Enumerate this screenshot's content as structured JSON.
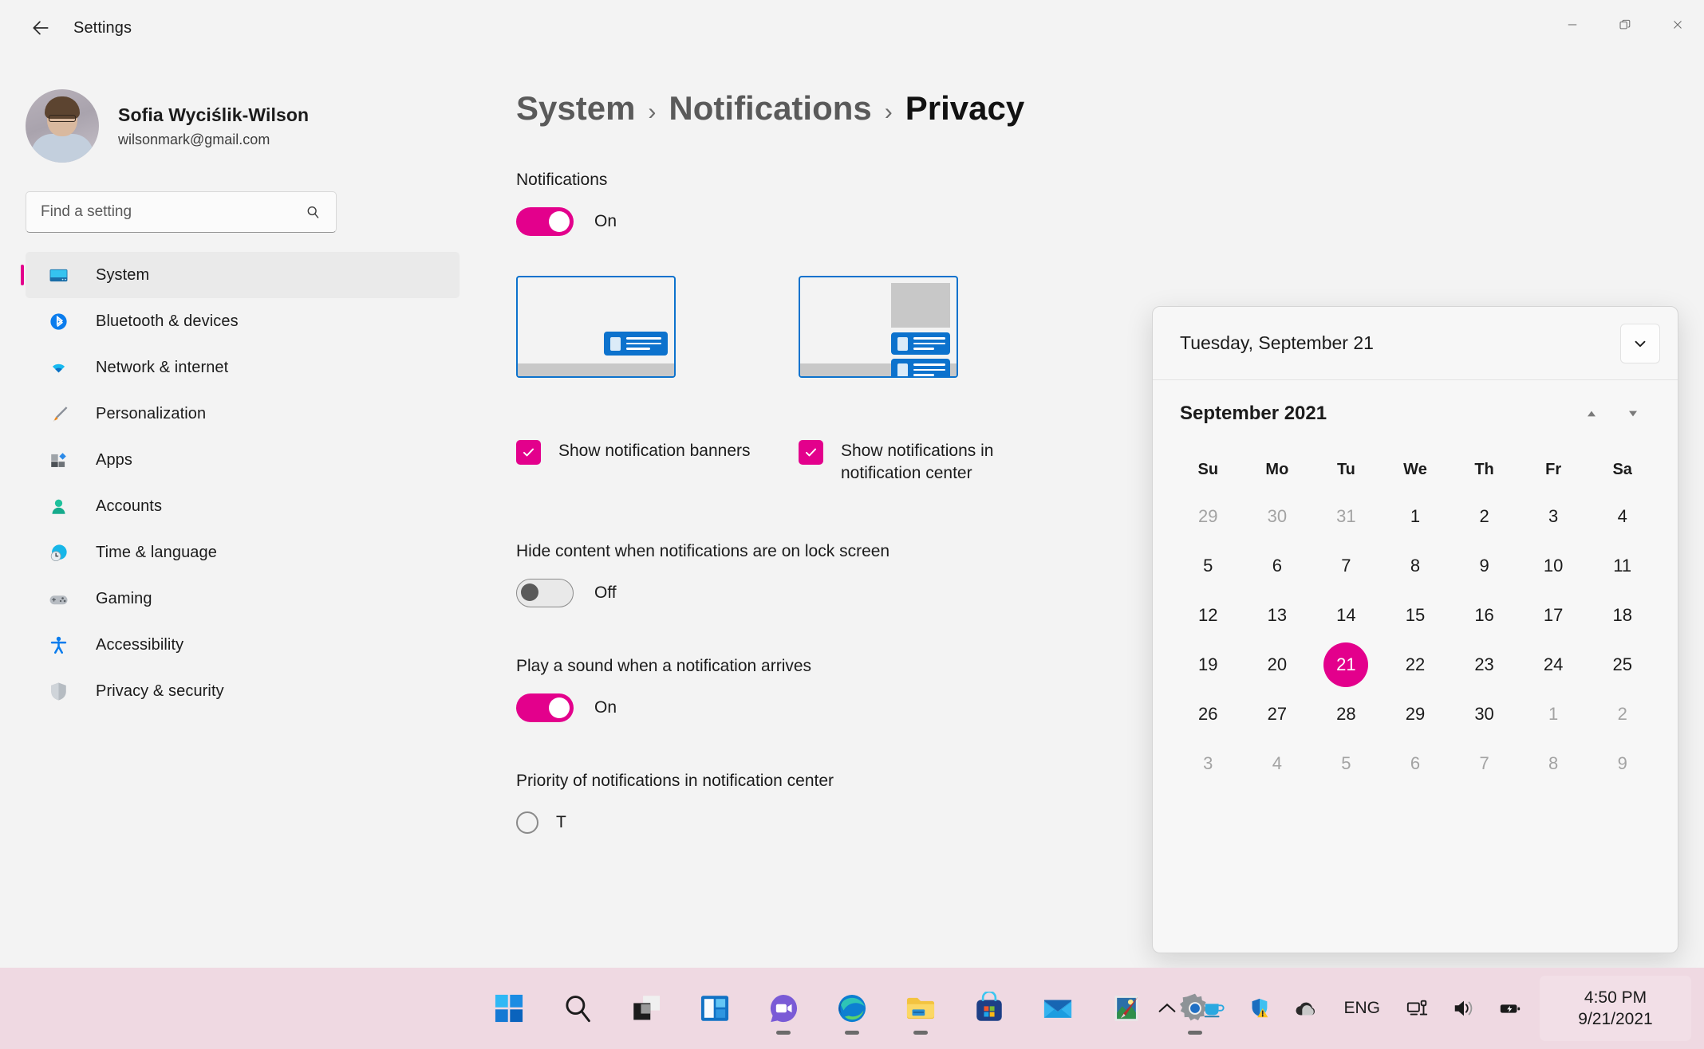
{
  "accent": "#E3008C",
  "window": {
    "title": "Settings",
    "back_icon": "arrow-left-icon",
    "minimize_label": "Minimize",
    "restore_label": "Restore",
    "close_label": "Close"
  },
  "sidebar": {
    "account": {
      "name": "Sofia Wyciślik-Wilson",
      "email": "wilsonmark@gmail.com"
    },
    "search": {
      "placeholder": "Find a setting",
      "icon": "search-icon"
    },
    "items": [
      {
        "label": "System",
        "icon": "monitor-icon",
        "active": true
      },
      {
        "label": "Bluetooth & devices",
        "icon": "bluetooth-icon",
        "active": false
      },
      {
        "label": "Network & internet",
        "icon": "wifi-icon",
        "active": false
      },
      {
        "label": "Personalization",
        "icon": "paintbrush-icon",
        "active": false
      },
      {
        "label": "Apps",
        "icon": "apps-icon",
        "active": false
      },
      {
        "label": "Accounts",
        "icon": "person-icon",
        "active": false
      },
      {
        "label": "Time & language",
        "icon": "clock-globe-icon",
        "active": false
      },
      {
        "label": "Gaming",
        "icon": "gamepad-icon",
        "active": false
      },
      {
        "label": "Accessibility",
        "icon": "accessibility-icon",
        "active": false
      },
      {
        "label": "Privacy & security",
        "icon": "shield-icon",
        "active": false
      }
    ]
  },
  "main": {
    "breadcrumb": [
      {
        "label": "System",
        "current": false
      },
      {
        "label": "Notifications",
        "current": false
      },
      {
        "label": "Privacy",
        "current": true
      }
    ],
    "breadcrumb_separator": "›",
    "notifications": {
      "label": "Notifications",
      "toggle_state": "On",
      "toggle_on": true
    },
    "previews": {
      "banner_preview_name": "notification-banner-preview",
      "center_preview_name": "notification-center-preview"
    },
    "checkboxes": [
      {
        "label": "Show notification banners",
        "checked": true
      },
      {
        "label": "Show notifications in notification center",
        "checked": true
      }
    ],
    "settings": [
      {
        "label": "Hide content when notifications are on lock screen",
        "toggle_state": "Off",
        "toggle_on": false
      },
      {
        "label": "Play a sound when a notification arrives",
        "toggle_state": "On",
        "toggle_on": true
      }
    ],
    "priority": {
      "label": "Priority of notifications in notification center",
      "first_option": "T"
    }
  },
  "calendar": {
    "header_title": "Tuesday, September 21",
    "expand_icon": "chevron-down-icon",
    "month_label": "September 2021",
    "prev_icon": "triangle-up-icon",
    "next_icon": "triangle-down-icon",
    "day_names": [
      "Su",
      "Mo",
      "Tu",
      "We",
      "Th",
      "Fr",
      "Sa"
    ],
    "weeks": [
      [
        {
          "d": "29",
          "muted": true
        },
        {
          "d": "30",
          "muted": true
        },
        {
          "d": "31",
          "muted": true
        },
        {
          "d": "1",
          "muted": false
        },
        {
          "d": "2",
          "muted": false
        },
        {
          "d": "3",
          "muted": false
        },
        {
          "d": "4",
          "muted": false
        }
      ],
      [
        {
          "d": "5",
          "muted": false
        },
        {
          "d": "6",
          "muted": false
        },
        {
          "d": "7",
          "muted": false
        },
        {
          "d": "8",
          "muted": false
        },
        {
          "d": "9",
          "muted": false
        },
        {
          "d": "10",
          "muted": false
        },
        {
          "d": "11",
          "muted": false
        }
      ],
      [
        {
          "d": "12",
          "muted": false
        },
        {
          "d": "13",
          "muted": false
        },
        {
          "d": "14",
          "muted": false
        },
        {
          "d": "15",
          "muted": false
        },
        {
          "d": "16",
          "muted": false
        },
        {
          "d": "17",
          "muted": false
        },
        {
          "d": "18",
          "muted": false
        }
      ],
      [
        {
          "d": "19",
          "muted": false
        },
        {
          "d": "20",
          "muted": false
        },
        {
          "d": "21",
          "muted": false,
          "today": true
        },
        {
          "d": "22",
          "muted": false
        },
        {
          "d": "23",
          "muted": false
        },
        {
          "d": "24",
          "muted": false
        },
        {
          "d": "25",
          "muted": false
        }
      ],
      [
        {
          "d": "26",
          "muted": false
        },
        {
          "d": "27",
          "muted": false
        },
        {
          "d": "28",
          "muted": false
        },
        {
          "d": "29",
          "muted": false
        },
        {
          "d": "30",
          "muted": false
        },
        {
          "d": "1",
          "muted": true
        },
        {
          "d": "2",
          "muted": true
        }
      ],
      [
        {
          "d": "3",
          "muted": true
        },
        {
          "d": "4",
          "muted": true
        },
        {
          "d": "5",
          "muted": true
        },
        {
          "d": "6",
          "muted": true
        },
        {
          "d": "7",
          "muted": true
        },
        {
          "d": "8",
          "muted": true
        },
        {
          "d": "9",
          "muted": true
        }
      ]
    ]
  },
  "taskbar": {
    "apps": [
      {
        "name": "start-icon",
        "label": "Start",
        "running": false
      },
      {
        "name": "search-icon",
        "label": "Search",
        "running": false
      },
      {
        "name": "task-view-icon",
        "label": "Task View",
        "running": false
      },
      {
        "name": "widgets-icon",
        "label": "Widgets",
        "running": false
      },
      {
        "name": "chat-icon",
        "label": "Chat",
        "running": true
      },
      {
        "name": "edge-icon",
        "label": "Microsoft Edge",
        "running": true
      },
      {
        "name": "file-explorer-icon",
        "label": "File Explorer",
        "running": true
      },
      {
        "name": "microsoft-store-icon",
        "label": "Microsoft Store",
        "running": false
      },
      {
        "name": "mail-icon",
        "label": "Mail",
        "running": false
      },
      {
        "name": "paint-icon",
        "label": "Paint",
        "running": false
      },
      {
        "name": "settings-icon",
        "label": "Settings",
        "running": true
      }
    ],
    "tray": [
      {
        "name": "chevron-up-icon",
        "label": "Show hidden icons"
      },
      {
        "name": "coffee-cup-icon",
        "label": "Caffeine"
      },
      {
        "name": "defender-shield-warning-icon",
        "label": "Windows Security"
      },
      {
        "name": "onedrive-cloud-icon",
        "label": "OneDrive"
      }
    ],
    "language": "ENG",
    "status": [
      {
        "name": "network-remote-icon",
        "label": "Network"
      },
      {
        "name": "volume-icon",
        "label": "Volume"
      },
      {
        "name": "battery-icon",
        "label": "Battery"
      }
    ],
    "clock": {
      "time": "4:50 PM",
      "date": "9/21/2021"
    }
  }
}
